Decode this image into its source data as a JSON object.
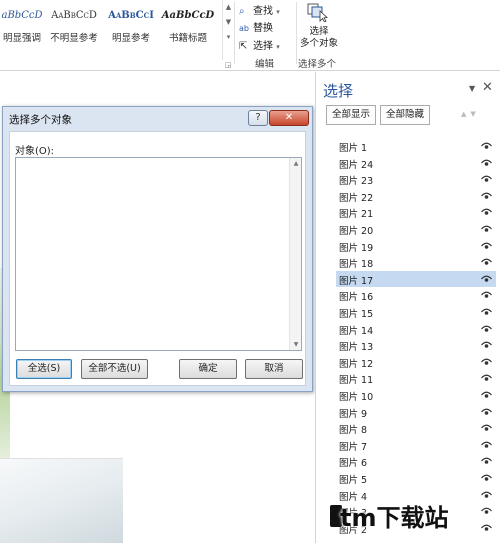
{
  "ribbon": {
    "styles": [
      {
        "sample": "aBbCcD",
        "label": "明显强调",
        "color": "#2b579a",
        "italic": true
      },
      {
        "sample": "AaBbCcD",
        "label": "不明显参考",
        "color": "#333333",
        "italic": false
      },
      {
        "sample": "AaBbCcI",
        "label": "明显参考",
        "color": "#2b579a",
        "italic": false
      },
      {
        "sample": "AaBbCcD",
        "label": "书籍标题",
        "color": "#222222",
        "italic": true
      }
    ],
    "edit": {
      "find_label": "查找",
      "replace_label": "替换",
      "select_label": "选择",
      "group_label": "编辑"
    },
    "select_multiple": {
      "label_line1": "选择",
      "label_line2": "多个对象",
      "group_label": "选择多个"
    }
  },
  "dialog": {
    "title": "选择多个对象",
    "help": "?",
    "close": "✕",
    "objects_label": "对象(O):",
    "buttons": {
      "select_all": "全选(S)",
      "deselect_all": "全部不选(U)",
      "ok": "确定",
      "cancel": "取消"
    }
  },
  "pane": {
    "title": "选择",
    "show_all": "全部显示",
    "hide_all": "全部隐藏",
    "items": [
      {
        "name": "图片 1",
        "selected": false
      },
      {
        "name": "图片 24",
        "selected": false
      },
      {
        "name": "图片 23",
        "selected": false
      },
      {
        "name": "图片 22",
        "selected": false
      },
      {
        "name": "图片 21",
        "selected": false
      },
      {
        "name": "图片 20",
        "selected": false
      },
      {
        "name": "图片 19",
        "selected": false
      },
      {
        "name": "图片 18",
        "selected": false
      },
      {
        "name": "图片 17",
        "selected": true
      },
      {
        "name": "图片 16",
        "selected": false
      },
      {
        "name": "图片 15",
        "selected": false
      },
      {
        "name": "图片 14",
        "selected": false
      },
      {
        "name": "图片 13",
        "selected": false
      },
      {
        "name": "图片 12",
        "selected": false
      },
      {
        "name": "图片 11",
        "selected": false
      },
      {
        "name": "图片 10",
        "selected": false
      },
      {
        "name": "图片 9",
        "selected": false
      },
      {
        "name": "图片 8",
        "selected": false
      },
      {
        "name": "图片 7",
        "selected": false
      },
      {
        "name": "图片 6",
        "selected": false
      },
      {
        "name": "图片 5",
        "selected": false
      },
      {
        "name": "图片 4",
        "selected": false
      },
      {
        "name": "图片 3",
        "selected": false
      },
      {
        "name": "图片 2",
        "selected": false
      }
    ],
    "selection_color": "#c5d9f1"
  },
  "watermark": "tm下载站"
}
